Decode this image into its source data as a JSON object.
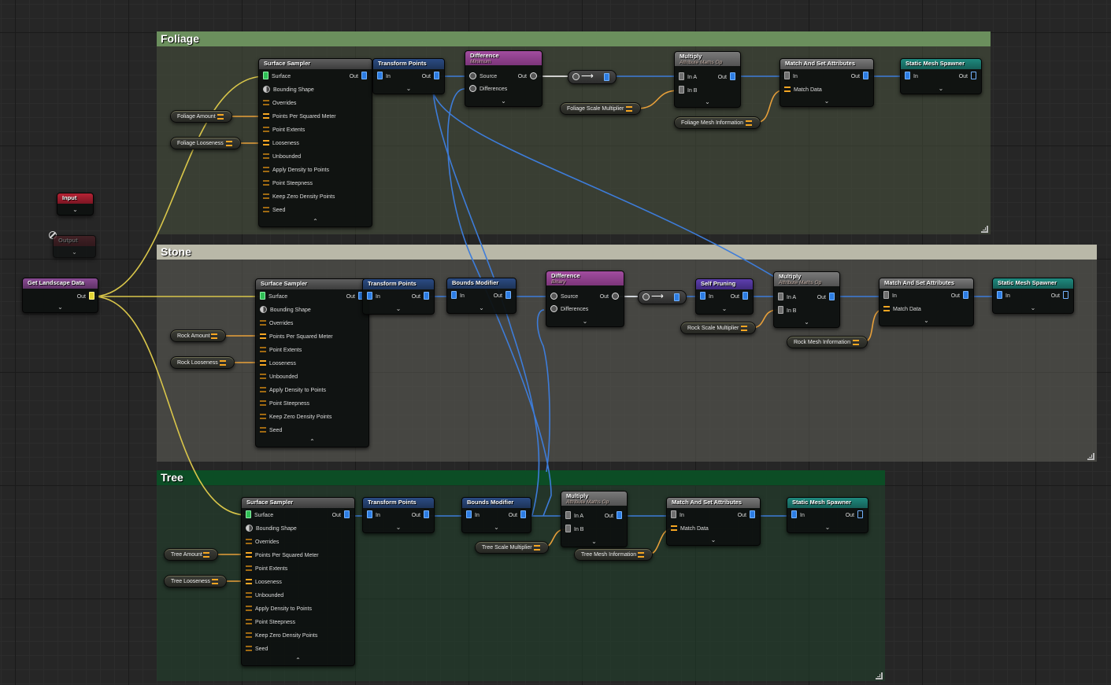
{
  "colors": {
    "foliage_title_bar": "#6b8f5d",
    "stone_title_bar": "#c3c2b2",
    "tree_title_bar": "#0c4d25",
    "spatial_wire": "#3d7cd9",
    "landscape_wire": "#d9c64a",
    "attribute_wire": "#e8a03a"
  },
  "comments": {
    "foliage": "Foliage",
    "stone": "Stone",
    "tree": "Tree"
  },
  "global": {
    "input": {
      "title": "Input"
    },
    "output": {
      "title": "Output"
    },
    "landscape": {
      "title": "Get Landscape Data",
      "out": "Out"
    }
  },
  "sampler_pins": {
    "surface": "Surface",
    "bounding_shape": "Bounding Shape",
    "overrides": "Overrides",
    "points_per_sq_m": "Points Per Squared Meter",
    "point_extents": "Point Extents",
    "looseness": "Looseness",
    "unbounded": "Unbounded",
    "apply_density": "Apply Density to Points",
    "steepness": "Point Steepness",
    "keep_zero": "Keep Zero Density Points",
    "seed": "Seed",
    "out": "Out"
  },
  "pins": {
    "in": "In",
    "out": "Out",
    "in_a": "In A",
    "in_b": "In B",
    "source": "Source",
    "differences": "Differences",
    "match_data": "Match Data"
  },
  "node_titles": {
    "surface_sampler": "Surface Sampler",
    "transform_points": "Transform Points",
    "bounds_modifier": "Bounds Modifier",
    "difference": "Difference",
    "multiply": "Multiply",
    "match_set": "Match And Set Attributes",
    "spawner": "Static Mesh Spawner",
    "self_pruning": "Self Pruning"
  },
  "node_subtitles": {
    "difference_foliage": "Minimum",
    "difference_stone": "Binary",
    "multiply": "Attribute Maths Op"
  },
  "params": {
    "foliage_amount": "Foliage Amount",
    "foliage_looseness": "Foliage Looseness",
    "foliage_scale": "Foliage Scale Multiplier",
    "foliage_mesh": "Foliage Mesh Information",
    "rock_amount": "Rock Amount",
    "rock_looseness": "Rock Looseness",
    "rock_scale": "Rock Scale Multiplier",
    "rock_mesh": "Rock Mesh Information",
    "tree_amount": "Tree Amount",
    "tree_looseness": "Tree Looseness",
    "tree_scale": "Tree Scale Multiplier",
    "tree_mesh": "Tree Mesh Information"
  }
}
